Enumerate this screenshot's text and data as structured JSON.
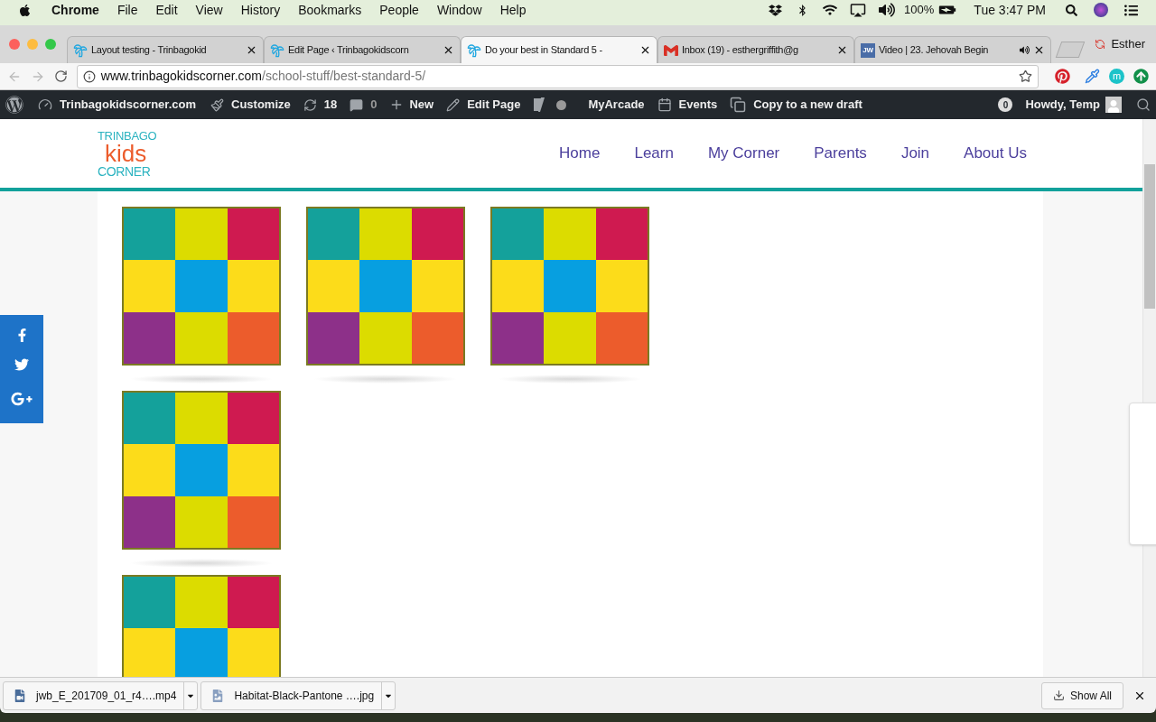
{
  "menu_bar": {
    "app": "Chrome",
    "items": [
      "File",
      "Edit",
      "View",
      "History",
      "Bookmarks",
      "People",
      "Window",
      "Help"
    ],
    "battery": "100%",
    "clock": "Tue 3:47 PM"
  },
  "tabs": [
    {
      "title": "Layout testing - Trinbagokid",
      "kind": "palm",
      "selected": false
    },
    {
      "title": "Edit Page ‹ Trinbagokidscorn",
      "kind": "palm",
      "selected": false
    },
    {
      "title": "Do your best in Standard 5 -",
      "kind": "palm",
      "selected": true
    },
    {
      "title": "Inbox (19) - esthergriffith@g",
      "kind": "mail",
      "selected": false
    },
    {
      "title": "Video | 23. Jehovah Begin",
      "kind": "badge",
      "favicon_text": "JW",
      "audio": true,
      "selected": false
    }
  ],
  "profile": "Esther",
  "address": {
    "host": "www.trinbagokidscorner.com",
    "path": "/school-stuff/best-standard-5/"
  },
  "extension_badge": "m",
  "admin_bar": {
    "site": "Trinbagokidscorner.com",
    "customize": "Customize",
    "updates": "18",
    "comments": "0",
    "new": "New",
    "edit": "Edit Page",
    "arcade": "MyArcade",
    "events": "Events",
    "copy": "Copy to a new draft",
    "notifications": "0",
    "howdy": "Howdy, Temp"
  },
  "logo": {
    "lines": [
      "TRINBAGO",
      "kids",
      "CORNER"
    ]
  },
  "nav": [
    "Home",
    "Learn",
    "My Corner",
    "Parents",
    "Join",
    "About Us"
  ],
  "content": {
    "rows": [
      {
        "tiles": [
          {
            "shadow": true,
            "cells": [
              {
                "color": "#14a19b"
              },
              {
                "color": "#dcdc00"
              },
              {
                "color": "#cf1a50"
              },
              {
                "color": "#fcdc1a"
              },
              {
                "color": "#079fe0"
              },
              {
                "color": "#fcdc1a"
              },
              {
                "color": "#8d3089"
              },
              {
                "color": "#dcdc00"
              },
              {
                "color": "#ec5c2c"
              }
            ]
          },
          {
            "shadow": true,
            "cells": [
              {
                "color": "#14a19b"
              },
              {
                "color": "#dcdc00"
              },
              {
                "color": "#cf1a50"
              },
              {
                "color": "#fcdc1a"
              },
              {
                "color": "#079fe0"
              },
              {
                "color": "#fcdc1a"
              },
              {
                "color": "#8d3089"
              },
              {
                "color": "#dcdc00"
              },
              {
                "color": "#ec5c2c"
              }
            ]
          },
          {
            "shadow": true,
            "cells": [
              {
                "color": "#14a19b"
              },
              {
                "color": "#dcdc00"
              },
              {
                "color": "#cf1a50"
              },
              {
                "color": "#fcdc1a"
              },
              {
                "color": "#079fe0"
              },
              {
                "color": "#fcdc1a"
              },
              {
                "color": "#8d3089"
              },
              {
                "color": "#dcdc00"
              },
              {
                "color": "#ec5c2c"
              }
            ]
          }
        ]
      },
      {
        "tiles": [
          {
            "shadow": true,
            "cells": [
              {
                "color": "#14a19b"
              },
              {
                "color": "#dcdc00"
              },
              {
                "color": "#cf1a50"
              },
              {
                "color": "#fcdc1a"
              },
              {
                "color": "#079fe0"
              },
              {
                "color": "#fcdc1a"
              },
              {
                "color": "#8d3089"
              },
              {
                "color": "#dcdc00"
              },
              {
                "color": "#ec5c2c"
              }
            ]
          }
        ]
      },
      {
        "tiles": [
          {
            "cells": [
              {
                "color": "#14a19b"
              },
              {
                "color": "#dcdc00"
              },
              {
                "color": "#cf1a50"
              },
              {
                "color": "#fcdc1a"
              },
              {
                "color": "#079fe0"
              },
              {
                "color": "#fcdc1a"
              }
            ]
          }
        ]
      }
    ]
  },
  "downloads": [
    {
      "name": "jwb_E_201709_01_r4….mp4",
      "kind": "video"
    },
    {
      "name": "Habitat-Black-Pantone ….jpg",
      "kind": "image"
    }
  ],
  "show_all": "Show All"
}
